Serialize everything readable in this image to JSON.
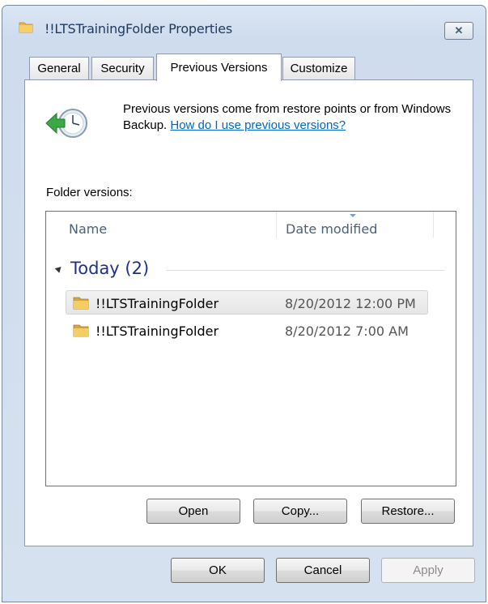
{
  "window": {
    "title": "!!LTSTrainingFolder Properties",
    "close_glyph": "✕"
  },
  "tabs": [
    {
      "label": "General"
    },
    {
      "label": "Security"
    },
    {
      "label": "Previous Versions"
    },
    {
      "label": "Customize"
    }
  ],
  "info": {
    "text": "Previous versions come from restore points or from Windows Backup.",
    "link": "How do I use previous versions?"
  },
  "folder_versions": {
    "label": "Folder versions:",
    "columns": {
      "name": "Name",
      "date": "Date modified"
    },
    "group": {
      "title": "Today (2)"
    },
    "rows": [
      {
        "name": "!!LTSTrainingFolder",
        "date": "8/20/2012 12:00 PM",
        "selected": true
      },
      {
        "name": "!!LTSTrainingFolder",
        "date": "8/20/2012 7:00 AM",
        "selected": false
      }
    ]
  },
  "actions": {
    "open": "Open",
    "copy": "Copy...",
    "restore": "Restore..."
  },
  "footer": {
    "ok": "OK",
    "cancel": "Cancel",
    "apply": "Apply"
  }
}
